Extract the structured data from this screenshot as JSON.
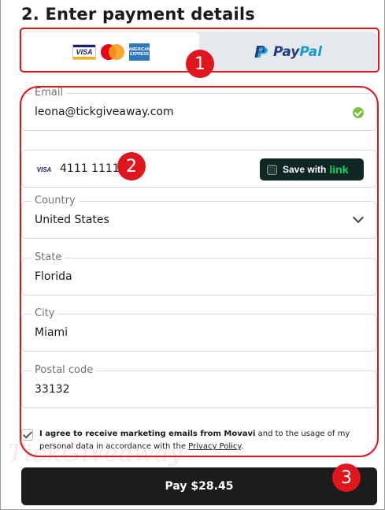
{
  "heading": "2. Enter payment details",
  "payment_methods": {
    "card_tab": {
      "icons": [
        "visa-icon",
        "mastercard-icon",
        "amex-icon"
      ],
      "visa_text": "VISA",
      "amex_text": "AMERICAN EXPRESS"
    },
    "paypal_tab": {
      "label_pay": "Pay",
      "label_pal": "Pal",
      "mark": "P"
    }
  },
  "form": {
    "email": {
      "label": "Email",
      "value": "leona@tickgiveaway.com",
      "valid": true
    },
    "card": {
      "brand": "VISA",
      "number": "4111 1111 11",
      "save_label": "Save with",
      "link_word": "link"
    },
    "country": {
      "label": "Country",
      "value": "United States"
    },
    "state": {
      "label": "State",
      "value": "Florida"
    },
    "city": {
      "label": "City",
      "value": "Miami"
    },
    "postal": {
      "label": "Postal code",
      "value": "33132"
    }
  },
  "consent": {
    "checked": true,
    "bold_text": "I agree to receive marketing emails from Movavi",
    "text": " and to the usage of my personal data in accordance with the ",
    "link": "Privacy Policy",
    "end": "."
  },
  "watermark": "TickGiveaway",
  "pay_button": {
    "label": "Pay $28.45"
  },
  "annotations": {
    "badge1": "1",
    "badge2": "2",
    "badge3": "3",
    "color": "#e0161e"
  }
}
